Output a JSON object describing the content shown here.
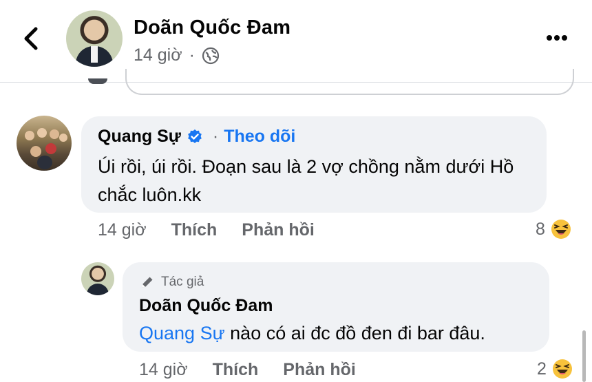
{
  "header": {
    "author_name": "Doãn Quốc Đam",
    "time": "14 giờ",
    "dot": "·"
  },
  "comments": [
    {
      "name": "Quang Sự",
      "verified": true,
      "follow_label": "Theo dõi",
      "text": "Úi rồi, úi rồi. Đoạn sau là 2 vợ chồng nằm dưới Hồ chắc luôn.kk",
      "time": "14 giờ",
      "like_label": "Thích",
      "reply_label": "Phản hồi",
      "reaction_count": "8",
      "reaction_icon": "laugh-emoji"
    }
  ],
  "reply": {
    "badge": "Tác giả",
    "name": "Doãn Quốc Đam",
    "mention": "Quang Sự",
    "text": " nào có ai đc đồ đen đi bar đâu.",
    "time": "14 giờ",
    "like_label": "Thích",
    "reply_label": "Phản hồi",
    "reaction_count": "2",
    "reaction_icon": "laugh-emoji"
  },
  "colors": {
    "link_blue": "#1876f2",
    "secondary_text": "#65676b",
    "bubble_bg": "#f0f2f5"
  }
}
